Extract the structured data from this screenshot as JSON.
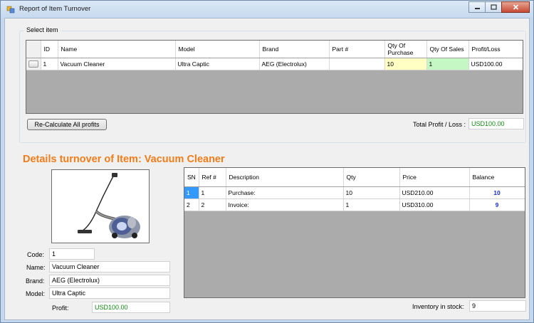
{
  "window": {
    "title": "Report of Item Turnover"
  },
  "select_group": {
    "label": "Select item"
  },
  "items_grid": {
    "columns": [
      "ID",
      "Name",
      "Model",
      "Brand",
      "Part #",
      "Qty Of Purchase",
      "Qty Of Sales",
      "Profit/Loss"
    ],
    "rows": [
      {
        "id": "1",
        "name": "Vacuum Cleaner",
        "model": "Ultra Captic",
        "brand": "AEG (Electrolux)",
        "part": "",
        "qty_purchase": "10",
        "qty_sales": "1",
        "profit": "USD100.00"
      }
    ]
  },
  "recalc_button": {
    "label": "Re-Calculate All profits"
  },
  "total_profit": {
    "label": "Total Profit / Loss :",
    "value": "USD100.00"
  },
  "details": {
    "title": "Details  turnover of Item: Vacuum Cleaner"
  },
  "item_info": {
    "code_label": "Code:",
    "code": "1",
    "name_label": "Name:",
    "name": "Vacuum Cleaner",
    "brand_label": "Brand:",
    "brand": "AEG (Electrolux)",
    "model_label": "Model:",
    "model": "Ultra Captic",
    "profit_label": "Profit:",
    "profit": "USD100.00"
  },
  "turnover_grid": {
    "columns": [
      "SN",
      "Ref #",
      "Description",
      "Qty",
      "Price",
      "Balance"
    ],
    "rows": [
      {
        "sn": "1",
        "ref": "1",
        "description": "Purchase:",
        "qty": "10",
        "price": "USD210.00",
        "balance": "10"
      },
      {
        "sn": "2",
        "ref": "2",
        "description": "Invoice:",
        "qty": "1",
        "price": "USD310.00",
        "balance": "9"
      }
    ]
  },
  "inventory": {
    "label": "Inventory in stock:",
    "value": "9"
  },
  "colors": {
    "accent_orange": "#f07d1a",
    "profit_green": "#0f8a0f",
    "balance_blue": "#1a2fd0",
    "selection_blue": "#3399ff",
    "purchase_cell": "#ffffc4",
    "sales_cell": "#c4f7c4"
  },
  "icons": {
    "app": "app-icon",
    "minimize": "minimize-icon",
    "maximize": "maximize-icon",
    "close": "close-icon",
    "product": "vacuum-cleaner-image"
  }
}
